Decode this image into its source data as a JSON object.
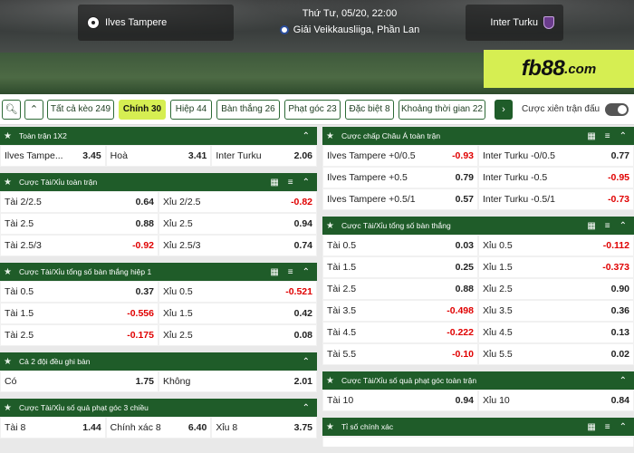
{
  "match": {
    "home": "Ilves Tampere",
    "away": "Inter Turku",
    "datetime": "Thứ Tư, 05/20, 22:00",
    "league": "Giải Veikkausliiga, Phần Lan"
  },
  "logo": {
    "main": "fb88",
    "suffix": ".com"
  },
  "tabs": [
    {
      "label": "Tất cả kèo 249",
      "w": 74
    },
    {
      "label": "Chính 30",
      "w": 52,
      "active": true
    },
    {
      "label": "Hiệp 44",
      "w": 46
    },
    {
      "label": "Bàn thắng 26",
      "w": 70
    },
    {
      "label": "Phạt góc 23",
      "w": 62
    },
    {
      "label": "Đặc biệt 8",
      "w": 54
    },
    {
      "label": "Khoảng thời gian 22",
      "w": 96
    }
  ],
  "parlay_label": "Cược xiên trận đấu",
  "left": [
    {
      "title": "Toàn trận 1X2",
      "tools": "caret",
      "rows": [
        [
          [
            "Ilves Tampe...",
            "3.45"
          ],
          [
            "Hoà",
            "3.41"
          ],
          [
            "Inter Turku",
            "2.06"
          ]
        ]
      ]
    },
    {
      "title": "Cược Tài/Xỉu toàn trận",
      "tools": "full",
      "rows": [
        [
          [
            "Tài 2/2.5",
            "0.64"
          ],
          [
            "Xỉu 2/2.5",
            "-0.82"
          ]
        ],
        [
          [
            "Tài 2.5",
            "0.88"
          ],
          [
            "Xỉu 2.5",
            "0.94"
          ]
        ],
        [
          [
            "Tài 2.5/3",
            "-0.92"
          ],
          [
            "Xỉu 2.5/3",
            "0.74"
          ]
        ]
      ]
    },
    {
      "title": "Cược Tài/Xỉu tổng số bàn thắng hiệp 1",
      "tools": "full",
      "rows": [
        [
          [
            "Tài 0.5",
            "0.37"
          ],
          [
            "Xỉu 0.5",
            "-0.521"
          ]
        ],
        [
          [
            "Tài 1.5",
            "-0.556"
          ],
          [
            "Xỉu 1.5",
            "0.42"
          ]
        ],
        [
          [
            "Tài 2.5",
            "-0.175"
          ],
          [
            "Xỉu 2.5",
            "0.08"
          ]
        ]
      ]
    },
    {
      "title": "Cả 2 đội đều ghi bàn",
      "tools": "caret",
      "rows": [
        [
          [
            "Có",
            "1.75"
          ],
          [
            "Không",
            "2.01"
          ]
        ]
      ]
    },
    {
      "title": "Cược Tài/Xỉu số quả phạt góc 3 chiều",
      "tools": "caret",
      "rows": [
        [
          [
            "Tài 8",
            "1.44"
          ],
          [
            "Chính xác 8",
            "6.40"
          ],
          [
            "Xỉu 8",
            "3.75"
          ]
        ]
      ]
    }
  ],
  "right": [
    {
      "title": "Cược chấp Châu Á toàn trận",
      "tools": "full",
      "rows": [
        [
          [
            "Ilves Tampere +0/0.5",
            "-0.93"
          ],
          [
            "Inter Turku -0/0.5",
            "0.77"
          ]
        ],
        [
          [
            "Ilves Tampere +0.5",
            "0.79"
          ],
          [
            "Inter Turku -0.5",
            "-0.95"
          ]
        ],
        [
          [
            "Ilves Tampere +0.5/1",
            "0.57"
          ],
          [
            "Inter Turku -0.5/1",
            "-0.73"
          ]
        ]
      ]
    },
    {
      "title": "Cược Tài/Xỉu tổng số bàn thắng",
      "tools": "full",
      "rows": [
        [
          [
            "Tài 0.5",
            "0.03"
          ],
          [
            "Xỉu 0.5",
            "-0.112"
          ]
        ],
        [
          [
            "Tài 1.5",
            "0.25"
          ],
          [
            "Xỉu 1.5",
            "-0.373"
          ]
        ],
        [
          [
            "Tài 2.5",
            "0.88"
          ],
          [
            "Xỉu 2.5",
            "0.90"
          ]
        ],
        [
          [
            "Tài 3.5",
            "-0.498"
          ],
          [
            "Xỉu 3.5",
            "0.36"
          ]
        ],
        [
          [
            "Tài 4.5",
            "-0.222"
          ],
          [
            "Xỉu 4.5",
            "0.13"
          ]
        ],
        [
          [
            "Tài 5.5",
            "-0.10"
          ],
          [
            "Xỉu 5.5",
            "0.02"
          ]
        ]
      ]
    },
    {
      "title": "Cược Tài/Xỉu số quả phạt góc toàn trận",
      "tools": "caret",
      "rows": [
        [
          [
            "Tài 10",
            "0.94"
          ],
          [
            "Xỉu 10",
            "0.84"
          ]
        ]
      ]
    },
    {
      "title": "Tỉ số chính xác",
      "tools": "full",
      "rows": []
    }
  ]
}
